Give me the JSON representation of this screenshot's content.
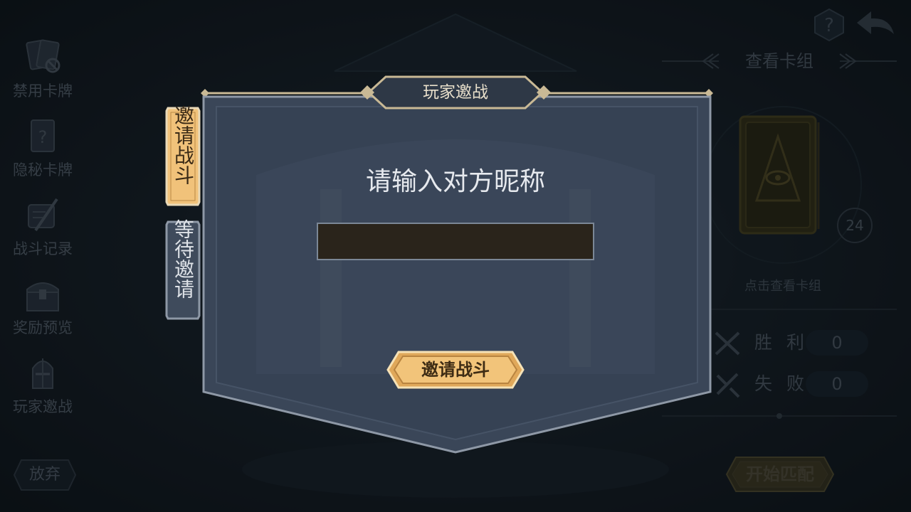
{
  "sidebar": {
    "items": [
      {
        "label": "禁用卡牌",
        "icon": "banned-cards-icon"
      },
      {
        "label": "隐秘卡牌",
        "icon": "secret-card-icon"
      },
      {
        "label": "战斗记录",
        "icon": "battle-record-icon"
      },
      {
        "label": "奖励预览",
        "icon": "treasure-chest-icon"
      },
      {
        "label": "玩家邀战",
        "icon": "knight-helmet-icon"
      }
    ],
    "abandon_label": "放弃"
  },
  "top_right": {
    "help_icon": "help-icon",
    "back_icon": "back-arrow-icon"
  },
  "deck": {
    "title": "查看卡组",
    "count": "24",
    "hint": "点击查看卡组"
  },
  "stats": {
    "win_label": "胜 利",
    "win_value": "0",
    "loss_label": "失 败",
    "loss_value": "0"
  },
  "match_button": "开始匹配",
  "dialog": {
    "title": "玩家邀战",
    "prompt": "请输入对方昵称",
    "input_value": "",
    "invite_button": "邀请战斗",
    "tabs": [
      {
        "label": "邀请战斗",
        "active": true
      },
      {
        "label": "等待邀请",
        "active": false
      }
    ]
  },
  "colors": {
    "accent_gold": "#f1c27a",
    "panel": "#3a4759",
    "panel_border": "#8d97a4",
    "inactive_tab": "#3f4b5c"
  }
}
